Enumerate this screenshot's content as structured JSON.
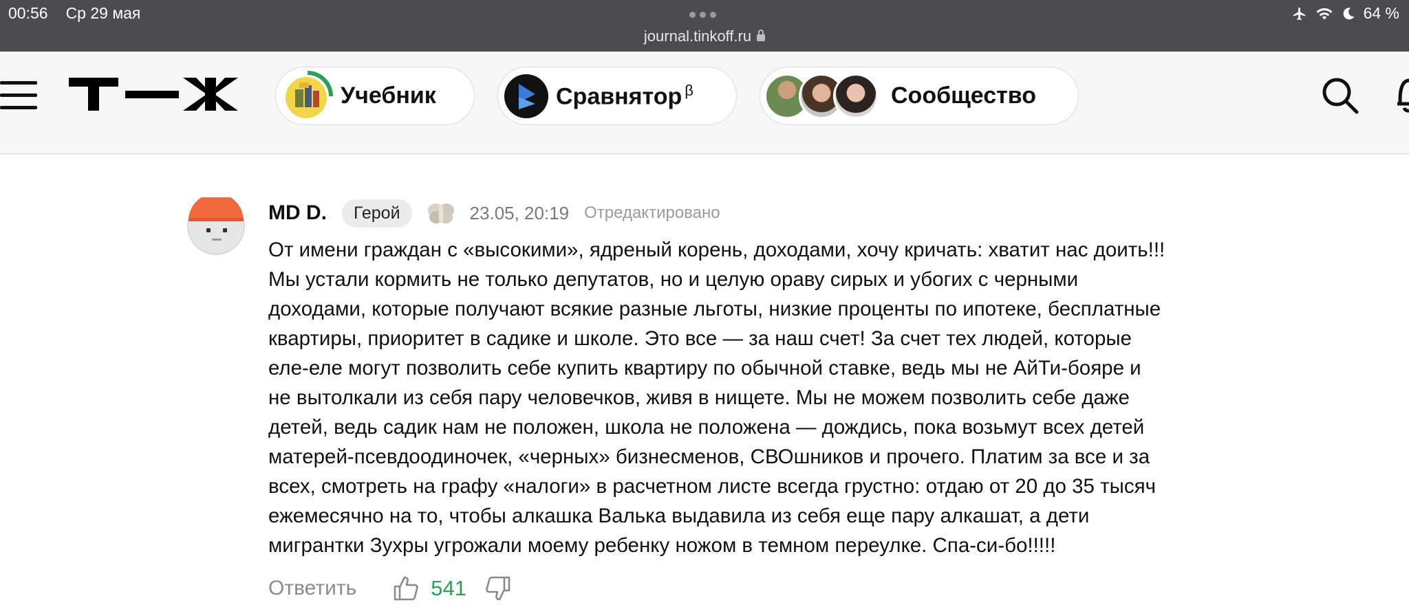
{
  "status_bar": {
    "time": "00:56",
    "date": "Ср 29 мая",
    "battery": "64 %",
    "url": "journal.tinkoff.ru",
    "icons": [
      "airplane-icon",
      "wifi-icon",
      "moon-icon",
      "battery-icon",
      "lock-icon"
    ]
  },
  "header": {
    "logo_text": "Т—Ж",
    "nav": [
      {
        "label": "Учебник",
        "icon": "textbook-icon"
      },
      {
        "label": "Сравнятор",
        "sup": "β",
        "icon": "compare-icon"
      },
      {
        "label": "Сообщество",
        "icon": "community-avatars"
      }
    ],
    "icons": [
      "menu-icon",
      "search-icon",
      "bell-icon"
    ]
  },
  "comment": {
    "author": "MD D.",
    "badge": "Герой",
    "date": "23.05, 20:19",
    "edited": "Отредактировано",
    "text": "От имени граждан с «высокими», ядреный корень, доходами, хочу кричать: хватит нас доить!!!\nМы устали кормить не только депутатов, но и целую ораву сирых и убогих с черными\nдоходами, которые получают всякие разные льготы, низкие проценты по ипотеке, бесплатные\nквартиры, приоритет в садике и школе. Это все — за наш счет! За счет тех людей, которые\nеле-еле могут позволить себе купить квартиру по обычной ставке, ведь мы не АйТи-бояре и\nне вытолкали из себя пару человечков, живя в нищете. Мы не можем позволить себе даже\nдетей, ведь садик нам не положен, школа не положена — дождись, пока возьмут всех детей\nматерей-псевдоодиночек, «черных» бизнесменов, СВОшников и прочего. Платим за все и за\nвсех, смотреть на графу «налоги» в расчетном листе всегда грустно: отдаю от 20 до 35 тысяч\nежемесячно на то, чтобы алкашка Валька выдавила из себя еще пару алкашат, а дети\nмигрантки Зухры угрожали моему ребенку ножом в темном переулке. Спа-си-бо!!!!!",
    "reply_label": "Ответить",
    "score": "541",
    "score_color": "#2e9e58"
  }
}
